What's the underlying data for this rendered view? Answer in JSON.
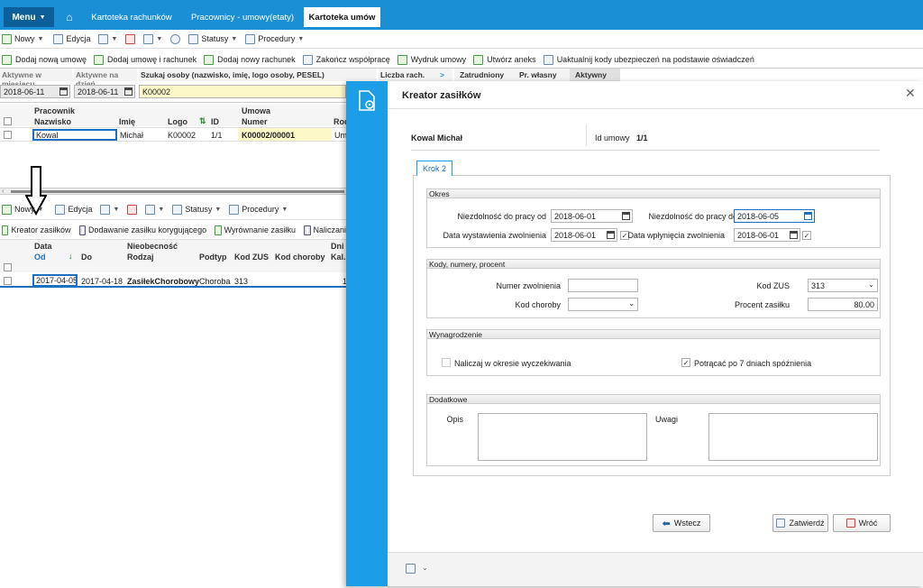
{
  "nav": {
    "menu_label": "Menu",
    "tabs": [
      "Kartoteka rachunków",
      "Pracownicy - umowy(etaty)",
      "Kartoteka umów"
    ]
  },
  "toolbar1": {
    "nowy": "Nowy",
    "edycja": "Edycja",
    "statusy": "Statusy",
    "procedury": "Procedury"
  },
  "toolbar2": {
    "items": [
      "Dodaj nową umowę",
      "Dodaj umowę i rachunek",
      "Dodaj nowy rachunek",
      "Zakończ współpracę",
      "Wydruk umowy",
      "Utwórz aneks",
      "Uaktualnij kody ubezpieczeń na podstawie oświadczeń"
    ]
  },
  "filters": {
    "aktywne_miesiacu_label": "Aktywne w miesiącu",
    "aktywne_dzien_label": "Aktywne na dzień",
    "szukaj_label": "Szukaj osoby (nazwisko, imię, logo osoby, PESEL)",
    "aktywne_miesiacu_value": "2018-06-11",
    "aktywne_dzien_value": "2018-06-11",
    "szukaj_value": "K00002",
    "tabs": [
      "Liczba rach.",
      "Zatrudniony",
      "Pr. własny",
      "Aktywny"
    ]
  },
  "grid1": {
    "group_pracownik": "Pracownik",
    "group_umowa": "Umowa",
    "headers": [
      "Nazwisko",
      "Imię",
      "Logo",
      "ID",
      "Numer",
      "Rod"
    ],
    "row": [
      "Kowal",
      "Michał",
      "K00002",
      "1/1",
      "K00002/00001",
      "Um"
    ]
  },
  "toolbar3": {
    "nowy": "Nowy",
    "edycja": "Edycja",
    "statusy": "Statusy",
    "procedury": "Procedury"
  },
  "toolbar4": {
    "items": [
      "Kreator zasiłków",
      "Dodawanie zasiłku korygującego",
      "Wyrównanie zasiłku",
      "Naliczani"
    ]
  },
  "grid2": {
    "group_data": "Data",
    "group_nieobecnosc": "Nieobecność",
    "group_dni": "Dni",
    "headers": [
      "Od",
      "Do",
      "Rodzaj",
      "Podtyp",
      "Kod ZUS",
      "Kod choroby",
      "Kal."
    ],
    "row": [
      "2017-04-05",
      "2017-04-18",
      "ZasiłekChorobowy",
      "Choroba",
      "313",
      "",
      "1"
    ]
  },
  "dialog": {
    "title": "Kreator zasiłków",
    "person": "Kowal Michał",
    "id_umowy_label": "Id umowy",
    "id_umowy_value": "1/1",
    "step_tab": "Krok 2",
    "okres": {
      "header": "Okres",
      "niezd_od_label": "Niezdolność do pracy od",
      "niezd_od_value": "2018-06-01",
      "niezd_do_label": "Niezdolność do pracy do",
      "niezd_do_value": "2018-06-05",
      "wystawienia_label": "Data wystawienia zwolnienia",
      "wystawienia_value": "2018-06-01",
      "wplyniecia_label": "Data wpłynięcia zwolnienia",
      "wplyniecia_value": "2018-06-01"
    },
    "kody": {
      "header": "Kody, numery, procent",
      "numer_label": "Numer zwolnienia",
      "numer_value": "",
      "kod_zus_label": "Kod ZUS",
      "kod_zus_value": "313",
      "kod_choroby_label": "Kod choroby",
      "kod_choroby_value": "",
      "procent_label": "Procent zasiłku",
      "procent_value": "80.00"
    },
    "wynagrodzenie": {
      "header": "Wynagrodzenie",
      "naliczaj_label": "Naliczaj w okresie wyczekiwania",
      "naliczaj_checked": false,
      "potracac_label": "Potrącać po 7 dniach spóźnienia",
      "potracac_checked": true
    },
    "dodatkowe": {
      "header": "Dodatkowe",
      "opis_label": "Opis",
      "uwagi_label": "Uwagi"
    },
    "buttons": {
      "wstecz": "Wstecz",
      "zatwierdz": "Zatwierdź",
      "wroc": "Wróć"
    }
  },
  "colors": {
    "nav_blue": "#1b8fd6",
    "side_blue": "#1b9ee6",
    "menu_dark": "#0d5f9a",
    "selected_yellow": "#fdf8c8"
  }
}
